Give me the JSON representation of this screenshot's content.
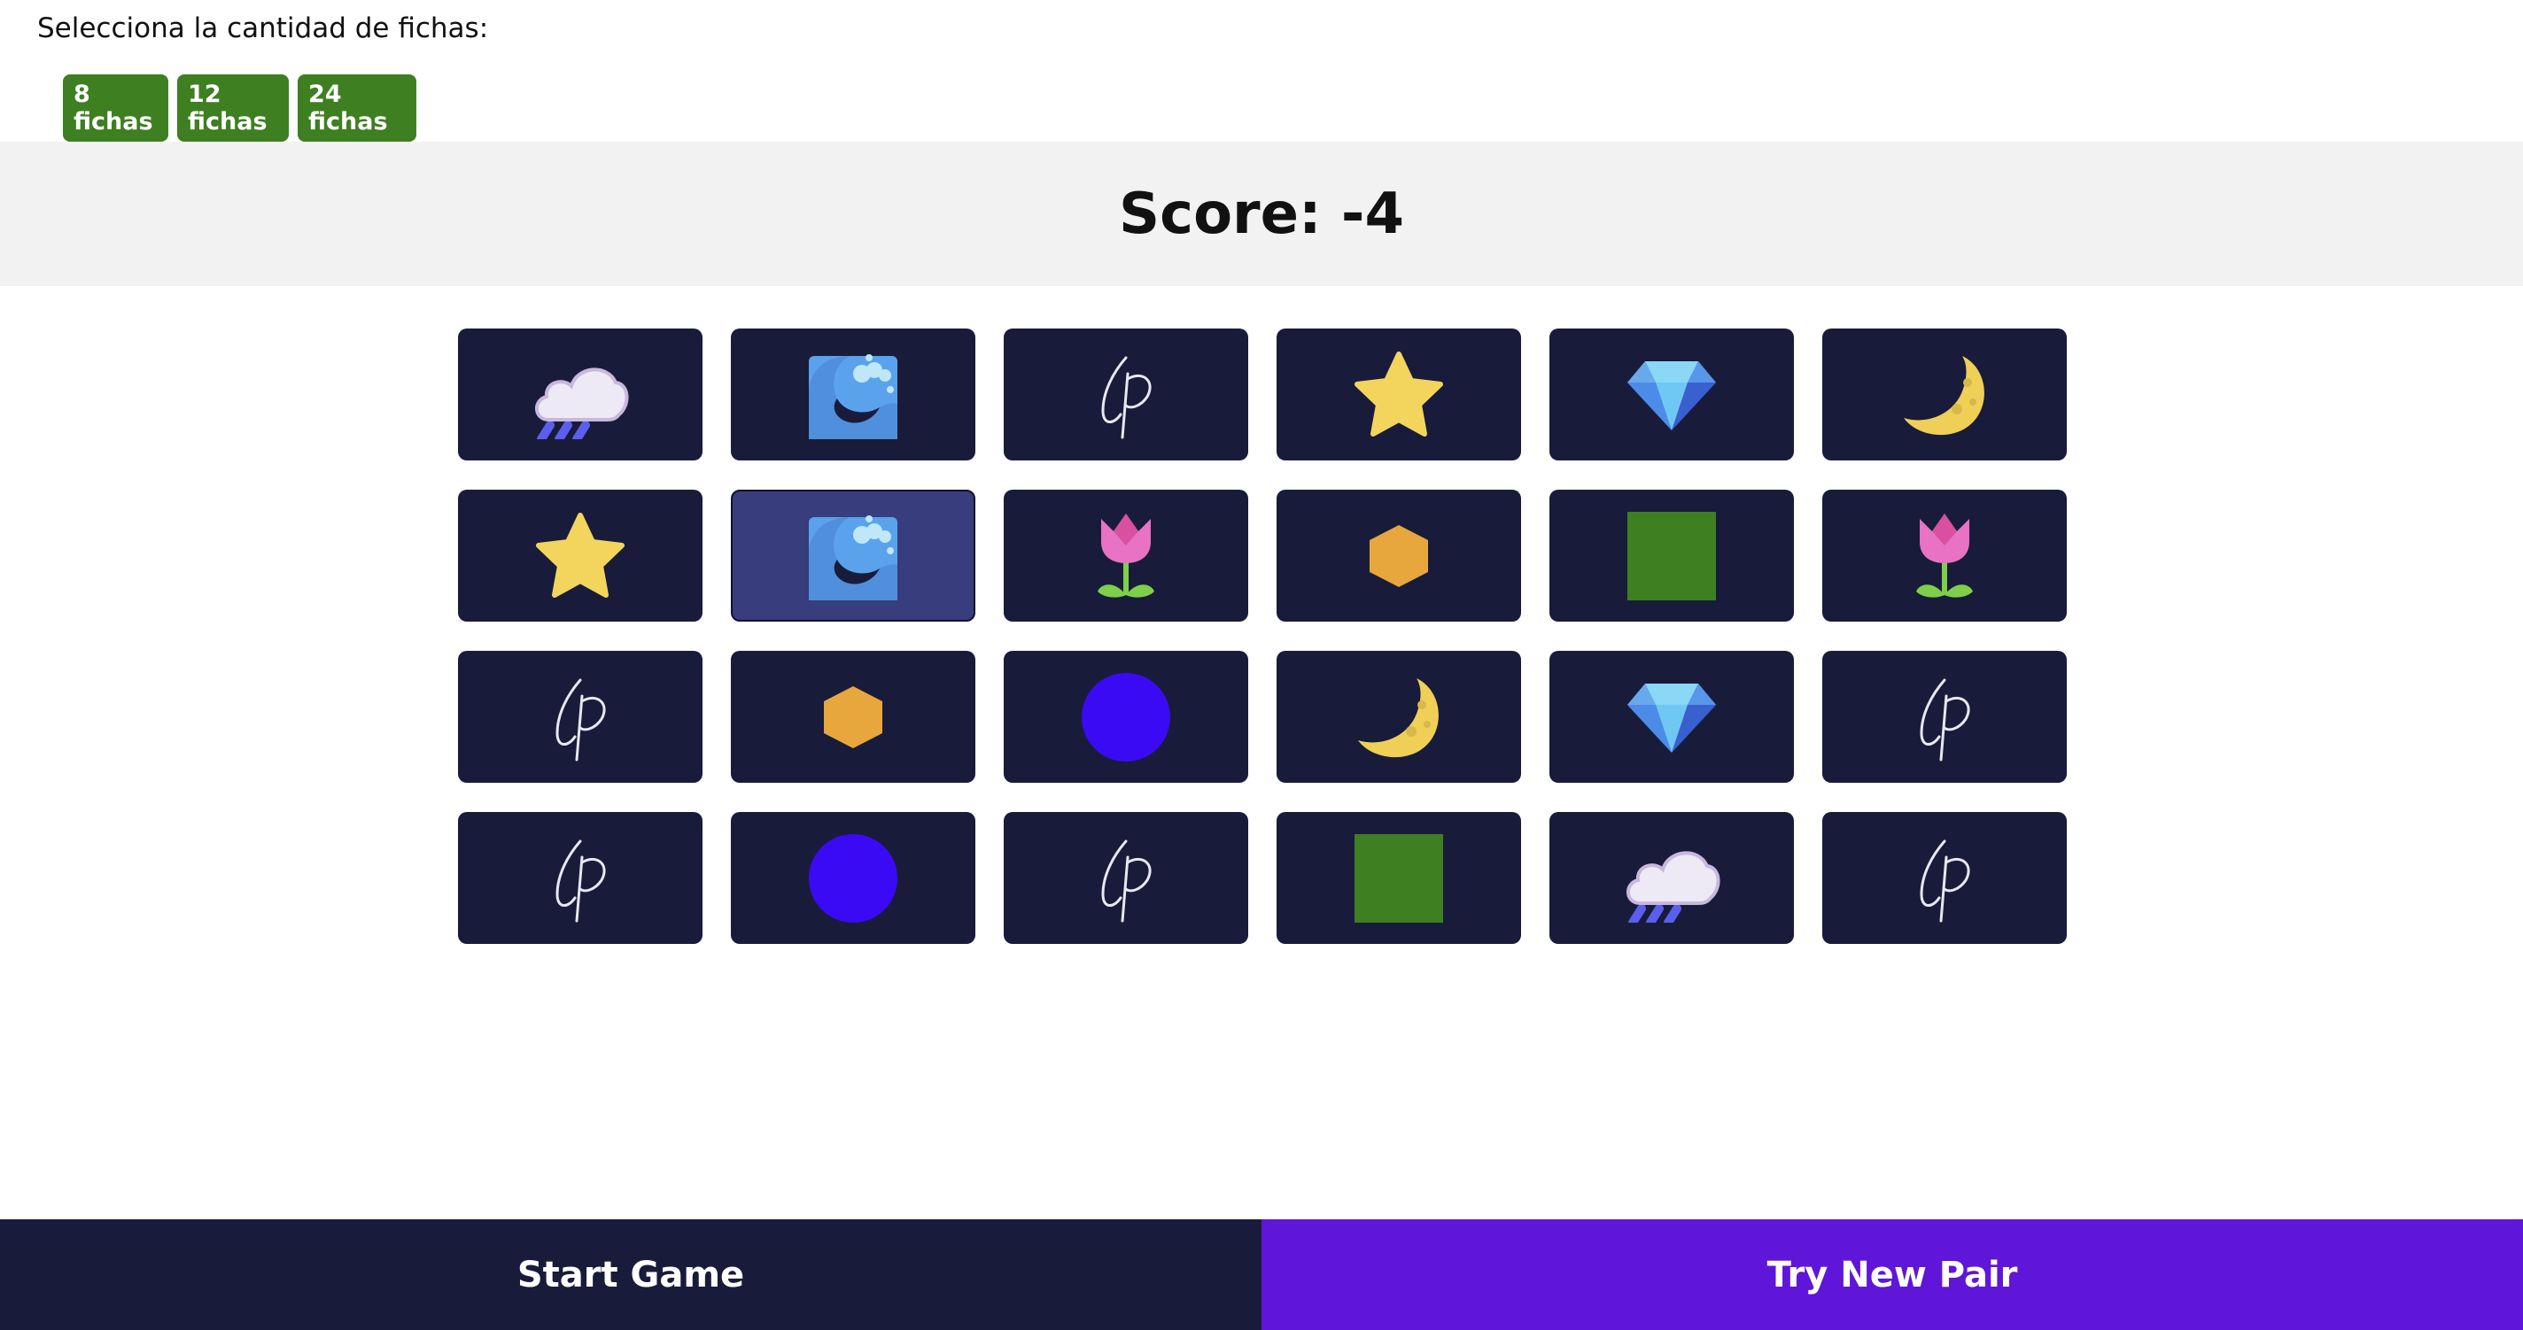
{
  "setup": {
    "prompt": "Selecciona la cantidad de fichas:",
    "options": [
      "8 fichas",
      "12 fichas",
      "24 fichas"
    ]
  },
  "score": {
    "text": "Score: -4"
  },
  "board": {
    "columns": 6,
    "selected_index": 7,
    "cards": [
      "rain-cloud",
      "wave",
      "card-back",
      "star",
      "diamond",
      "moon",
      "star",
      "wave",
      "tulip",
      "hexagon",
      "square",
      "tulip",
      "card-back",
      "hexagon",
      "circle",
      "moon",
      "diamond",
      "card-back",
      "card-back",
      "circle",
      "card-back",
      "square",
      "rain-cloud",
      "card-back"
    ]
  },
  "footer": {
    "start_label": "Start Game",
    "try_label": "Try New Pair"
  },
  "colors": {
    "button_green": "#3e7f21",
    "card_bg": "#181c3a",
    "card_selected": "#373d7d",
    "try_purple": "#5f16d9",
    "circle_blue": "#3b0af5",
    "square_green": "#3e7f21",
    "hexagon_orange": "#e8a73c",
    "star_yellow": "#f3d55e"
  }
}
